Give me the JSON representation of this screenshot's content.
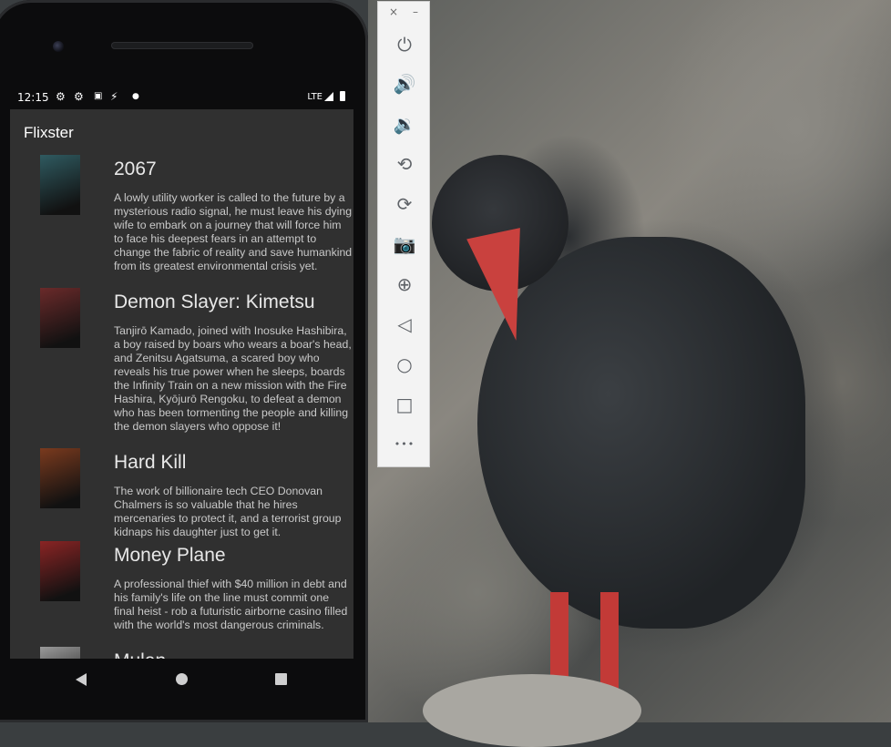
{
  "status_bar": {
    "time": "12:15",
    "network": "LTE",
    "icons": [
      "settings-icon",
      "settings-icon",
      "sim-icon",
      "data-saver-icon",
      "dot-icon"
    ]
  },
  "app": {
    "title": "Flixster",
    "movies": [
      {
        "title": "2067",
        "overview": "A lowly utility worker is called to the future by a mysterious radio signal, he must leave his dying wife to embark on a journey that will force him to face his deepest fears in an attempt to change the fabric of reality and save humankind from its greatest environmental crisis yet.",
        "poster_color": "#2f5a60"
      },
      {
        "title": "Demon Slayer: Kimetsu",
        "overview": "Tanjirō Kamado, joined with Inosuke Hashibira, a boy raised by boars who wears a boar's head, and Zenitsu Agatsuma, a scared boy who reveals his true power when he sleeps, boards the Infinity Train on a new mission with the Fire Hashira, Kyōjurō Rengoku, to defeat a demon who has been tormenting the people and killing the demon slayers who oppose it!",
        "poster_color": "#6a2a2a"
      },
      {
        "title": "Hard Kill",
        "overview": "The work of billionaire tech CEO Donovan Chalmers is so valuable that he hires mercenaries to protect it, and a terrorist group kidnaps his daughter just to get it.",
        "poster_color": "#7a3a1e"
      },
      {
        "title": "Money Plane",
        "overview": "A professional thief with $40 million in debt and his family's life on the line must commit one final heist - rob a futuristic airborne casino filled with the world's most dangerous criminals.",
        "poster_color": "#8a2424"
      },
      {
        "title": "Mulan",
        "overview": "",
        "poster_color": "#9a9a9a"
      }
    ]
  },
  "toolbar": {
    "close_glyph": "×",
    "minimize_glyph": "–",
    "buttons": [
      {
        "name": "power-icon",
        "glyph": "⏻"
      },
      {
        "name": "volume-up-icon",
        "glyph": "🔊"
      },
      {
        "name": "volume-down-icon",
        "glyph": "🔉"
      },
      {
        "name": "rotate-left-icon",
        "glyph": "⟲"
      },
      {
        "name": "rotate-right-icon",
        "glyph": "⟳"
      },
      {
        "name": "camera-icon",
        "glyph": "📷"
      },
      {
        "name": "zoom-icon",
        "glyph": "⊕"
      },
      {
        "name": "back-icon",
        "glyph": "◁"
      },
      {
        "name": "home-icon",
        "glyph": "○"
      },
      {
        "name": "overview-icon",
        "glyph": "□"
      },
      {
        "name": "more-icon",
        "glyph": "•••"
      }
    ]
  }
}
